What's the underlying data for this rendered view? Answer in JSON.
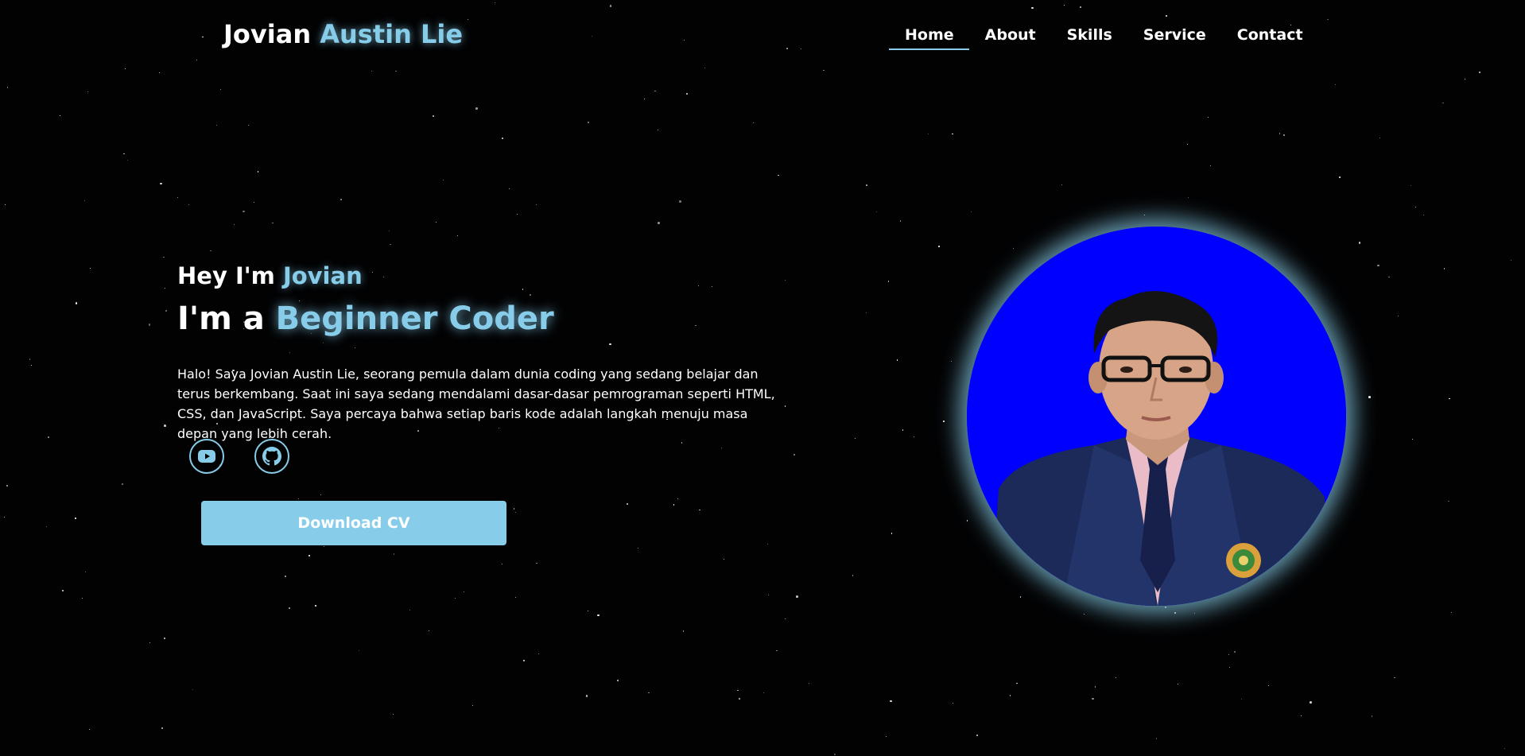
{
  "header": {
    "logo_first": "Jovian",
    "logo_accent": "Austin Lie",
    "nav": [
      {
        "label": "Home",
        "active": true
      },
      {
        "label": "About",
        "active": false
      },
      {
        "label": "Skills",
        "active": false
      },
      {
        "label": "Service",
        "active": false
      },
      {
        "label": "Contact",
        "active": false
      }
    ]
  },
  "hero": {
    "greeting_prefix": "Hey I'm",
    "greeting_name": "Jovian",
    "role_prefix": "I'm a",
    "role_accent": "Beginner Coder",
    "bio": "Halo! Saya Jovian Austin Lie, seorang pemula dalam dunia coding yang sedang belajar dan terus berkembang. Saat ini saya sedang mendalami dasar-dasar pemrograman seperti HTML, CSS, dan JavaScript. Saya percaya bahwa setiap baris kode adalah langkah menuju masa depan yang lebih cerah.",
    "socials": [
      {
        "icon": "youtube-icon"
      },
      {
        "icon": "github-icon"
      }
    ],
    "cta_label": "Download CV"
  },
  "colors": {
    "accent": "#87cdea",
    "background": "#000000",
    "profile_bg": "#0000ff"
  }
}
